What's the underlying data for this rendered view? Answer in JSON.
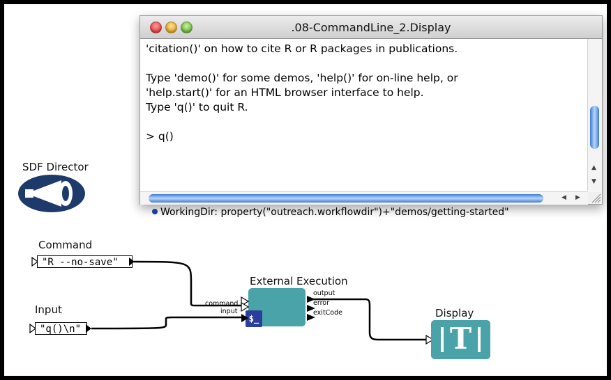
{
  "window": {
    "title": ".08-CommandLine_2.Display",
    "lines": [
      "'citation()' on how to cite R or R packages in publications.",
      "",
      "Type 'demo()' for some demos, 'help()' for on-line help, or",
      "'help.start()' for an HTML browser interface to help.",
      "Type 'q()' to quit R.",
      "",
      "> q()"
    ]
  },
  "director": {
    "label": "SDF Director"
  },
  "working_dir": {
    "text": "WorkingDir: property(\"outreach.workflowdir\")+\"demos/getting-started\""
  },
  "command_const": {
    "label": "Command",
    "value": "\"R --no-save\""
  },
  "input_const": {
    "label": "Input",
    "value": "\"q()\\n\""
  },
  "external_execution": {
    "label": "External Execution",
    "input_ports": [
      "command",
      "input"
    ],
    "output_ports": [
      "output",
      "error",
      "exitCode"
    ]
  },
  "display_actor": {
    "label": "Display",
    "icon_text": "T"
  },
  "colors": {
    "actor_teal": "#4aa3a8",
    "director_navy": "#1e3a6b",
    "scroll_blue": "#3d7bd6"
  }
}
